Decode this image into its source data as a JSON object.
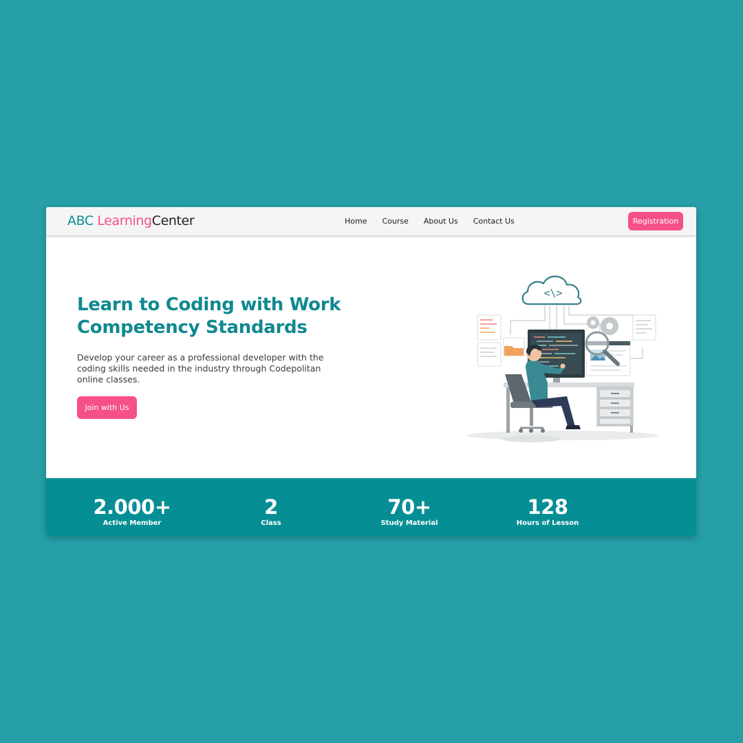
{
  "brand": {
    "part1": "ABC ",
    "part2": "Learning",
    "part3": "Center"
  },
  "nav": {
    "items": [
      "Home",
      "Course",
      "About Us",
      "Contact Us"
    ]
  },
  "header": {
    "registration_label": "Registration"
  },
  "hero": {
    "title": "Learn to Coding with Work Competency Standards",
    "description": "Develop your career as a professional developer with the coding skills needed in the industry through Codepolitan online classes.",
    "cta_label": "Join with Us",
    "illustration_icon": "developer-at-desk-illustration"
  },
  "stats": [
    {
      "value": "2.000+",
      "label": "Active Member"
    },
    {
      "value": "2",
      "label": "Class"
    },
    {
      "value": "70+",
      "label": "Study Material"
    },
    {
      "value": "128",
      "label": "Hours of Lesson"
    }
  ],
  "colors": {
    "page_bg": "#269fa7",
    "brand_teal": "#0e8f96",
    "accent_pink": "#f5508a",
    "stats_bg": "#068e95"
  }
}
